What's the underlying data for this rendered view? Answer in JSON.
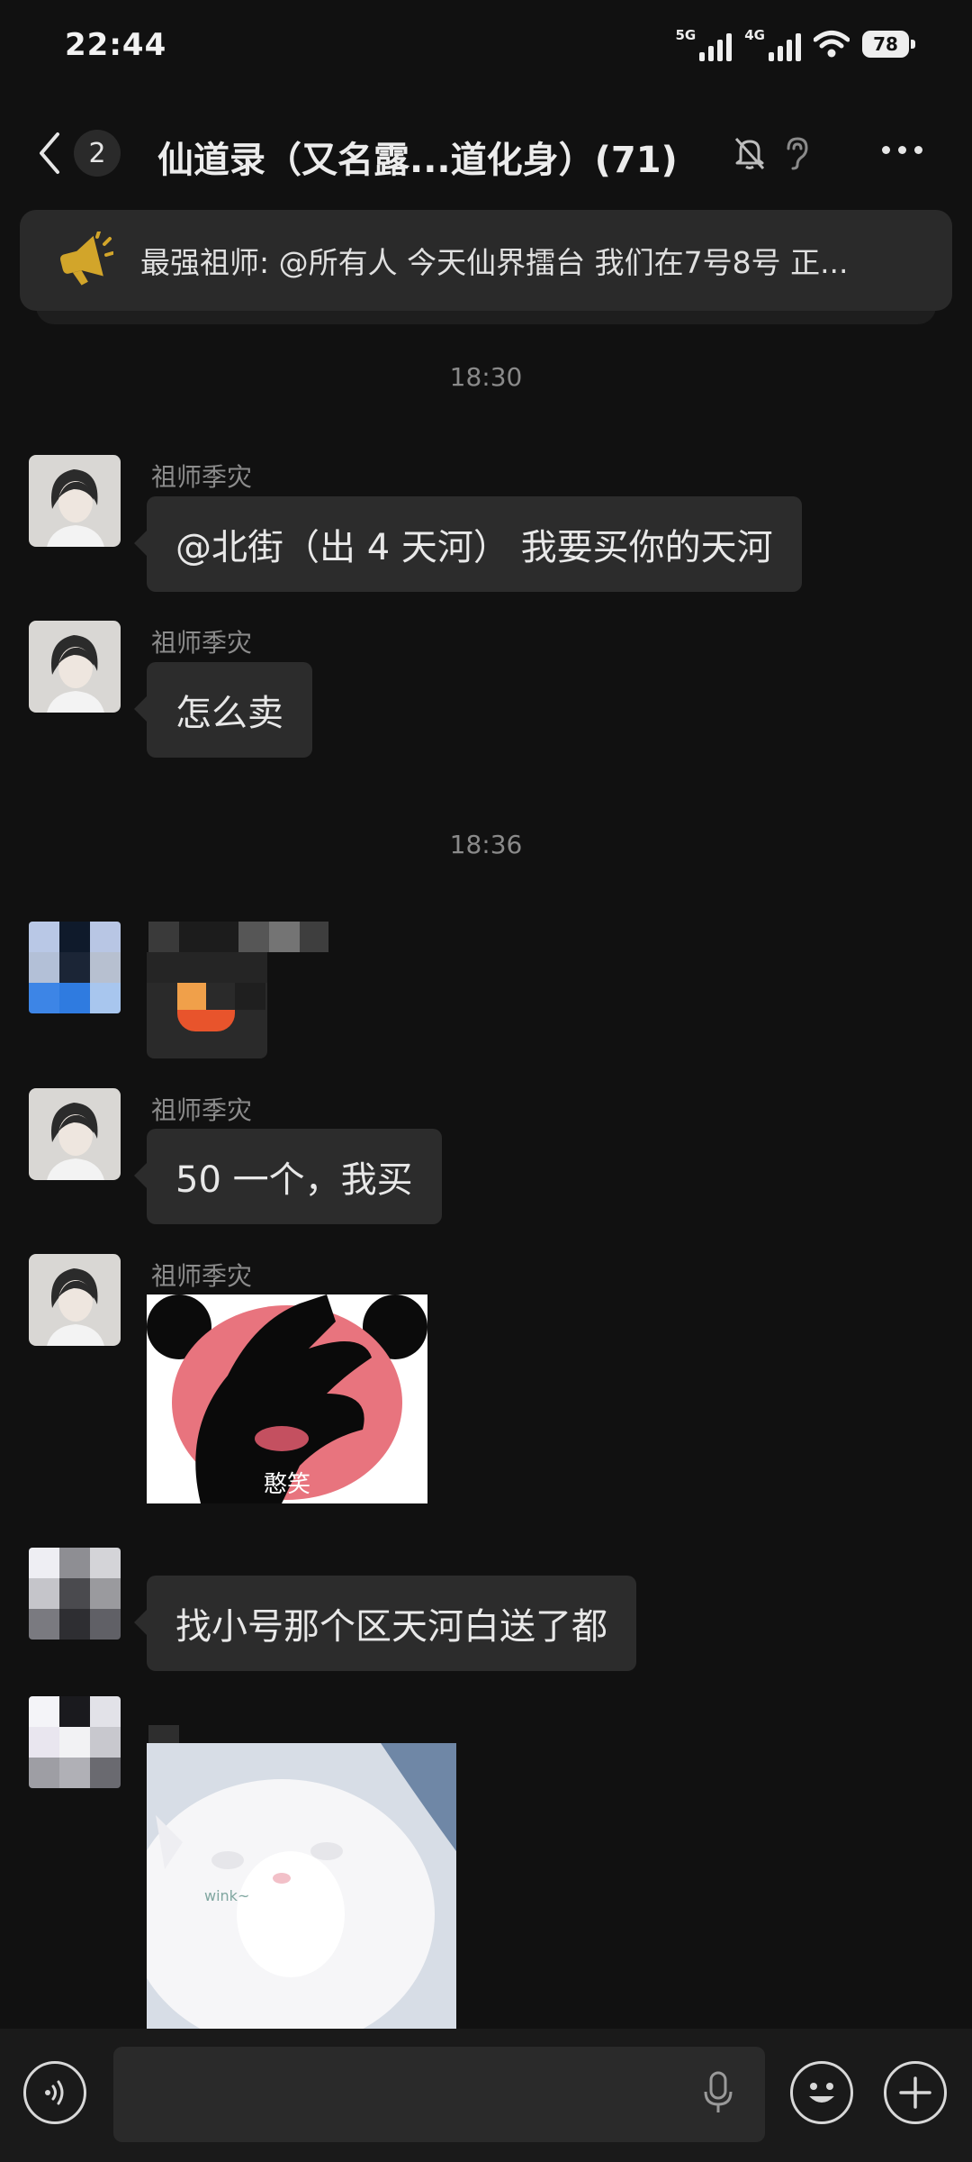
{
  "status_bar": {
    "time": "22:44",
    "network_1": "5G",
    "network_2": "4G",
    "battery": "78"
  },
  "header": {
    "unread_count": "2",
    "title": "仙道录（又名露...道化身）(71)"
  },
  "announcement": {
    "text": "最强祖师: @所有人 今天仙界擂台 我们在7号8号 正..."
  },
  "chat": {
    "time_1": "18:30",
    "time_2": "18:36",
    "messages": [
      {
        "sender": "祖师季灾",
        "text": "@北街（出 4 天河） 我要买你的天河"
      },
      {
        "sender": "祖师季灾",
        "text": "怎么卖"
      },
      {
        "sender": "",
        "text": ""
      },
      {
        "sender": "祖师季灾",
        "text": "50 一个，我买"
      },
      {
        "sender": "祖师季灾",
        "sticker_caption": "憨笑"
      },
      {
        "sender": "",
        "text": "找小号那个区天河白送了都"
      },
      {
        "sender": "",
        "sticker_caption": "wink~"
      }
    ]
  },
  "colors": {
    "background": "#111111",
    "bubble": "#2c2c2c",
    "announce_icon": "#d2a52a",
    "sticker_pink": "#e8747e"
  },
  "icons": [
    "back-icon",
    "mute-bell-icon",
    "ear-icon",
    "more-icon",
    "megaphone-icon",
    "voice-icon",
    "mic-icon",
    "emoji-icon",
    "plus-icon"
  ],
  "input": {
    "placeholder": ""
  }
}
